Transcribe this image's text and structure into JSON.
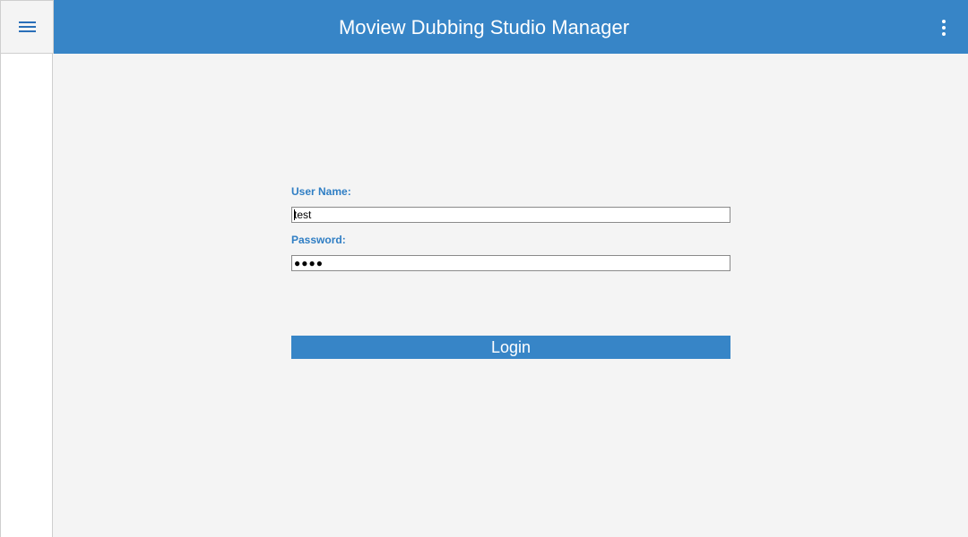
{
  "app": {
    "title": "Moview Dubbing Studio Manager",
    "accent_color": "#3785c7"
  },
  "header": {
    "menu_icon": "hamburger-icon",
    "more_icon": "more-vertical-icon"
  },
  "login_form": {
    "username_label": "User Name:",
    "username_value": "test",
    "password_label": "Password:",
    "password_value": "●●●●",
    "login_label": "Login"
  }
}
